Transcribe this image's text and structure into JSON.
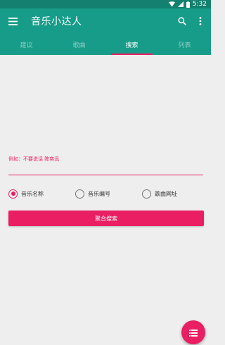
{
  "status_bar": {
    "time": "5:32",
    "icons": [
      "wifi-icon",
      "signal-icon",
      "battery-icon"
    ]
  },
  "toolbar": {
    "title": "音乐小达人",
    "menu_icon": "menu-icon",
    "search_icon": "search-icon",
    "more_icon": "more-vert-icon"
  },
  "tabs": [
    {
      "label": "建议",
      "active": false
    },
    {
      "label": "歌曲",
      "active": false
    },
    {
      "label": "搜索",
      "active": true
    },
    {
      "label": "列表",
      "active": false
    }
  ],
  "search_form": {
    "hint": "例如：不要说话 陈奕迅",
    "input_value": "",
    "radio_options": [
      {
        "label": "音乐名称",
        "checked": true
      },
      {
        "label": "音乐编号",
        "checked": false
      },
      {
        "label": "歌曲网址",
        "checked": false
      }
    ],
    "submit_label": "聚合搜索"
  },
  "fab": {
    "icon": "list-icon"
  },
  "colors": {
    "primary": "#179c89",
    "primary_dark": "#14806f",
    "accent": "#e91e63",
    "background": "#eeeeee"
  }
}
